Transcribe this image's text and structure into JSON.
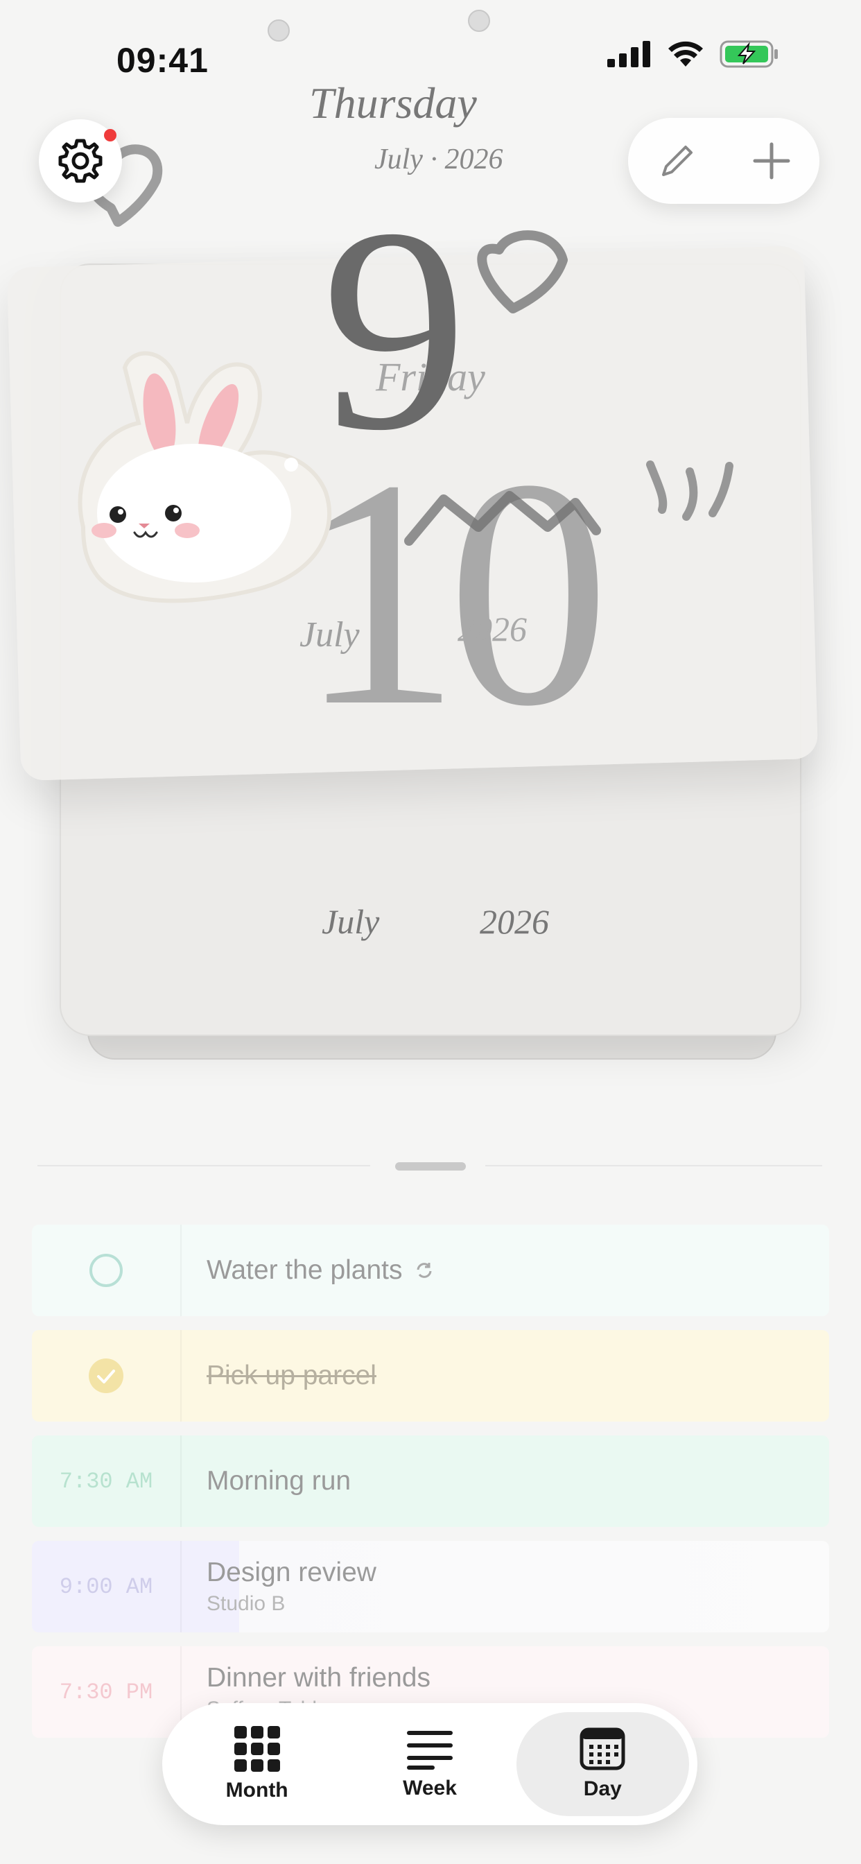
{
  "status_bar": {
    "time": "09:41"
  },
  "calendar": {
    "current_page": {
      "weekday": "Thursday",
      "month_year": "July · 2026",
      "day": "9"
    },
    "next_page": {
      "weekday": "Friday",
      "day": "10",
      "month": "July",
      "year": "2026"
    },
    "back_page": {
      "month": "July",
      "year": "2026"
    }
  },
  "tasks": [
    {
      "time": "",
      "title": "Water the plants",
      "subtitle": "",
      "repeat": true,
      "state": "open",
      "color": "#e8f6f3"
    },
    {
      "time": "",
      "title": "Pick up parcel",
      "subtitle": "",
      "repeat": false,
      "state": "done",
      "color": "#fdf6d9"
    },
    {
      "time": "7:30 AM",
      "title": "Morning run",
      "subtitle": "",
      "repeat": false,
      "state": "timed",
      "color": "#dff5ea"
    },
    {
      "time": "9:00 AM",
      "title": "Design review",
      "subtitle": "Studio B",
      "repeat": false,
      "state": "timed",
      "color": "#ecebfb"
    },
    {
      "time": "7:30 PM",
      "title": "Dinner with friends",
      "subtitle": "Saffron Table",
      "repeat": false,
      "state": "timed",
      "color": "#fcecef"
    }
  ],
  "tabs": [
    {
      "label": "Month",
      "icon": "grid-icon",
      "active": false
    },
    {
      "label": "Week",
      "icon": "lines-icon",
      "active": false
    },
    {
      "label": "Day",
      "icon": "calendar-icon",
      "active": true
    }
  ],
  "colors": {
    "notification_dot": "#ef3b3b",
    "battery": "#34c759"
  }
}
